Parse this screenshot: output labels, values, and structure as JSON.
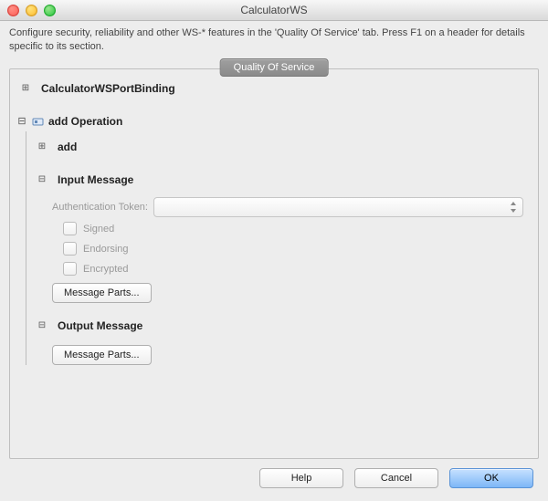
{
  "window": {
    "title": "CalculatorWS"
  },
  "info": "Configure security, reliability and other WS-* features in the 'Quality Of Service' tab. Press F1 on a header for details specific to its section.",
  "tab": {
    "label": "Quality Of Service"
  },
  "tree": {
    "binding": {
      "label": "CalculatorWSPortBinding"
    },
    "operation_group": {
      "label": "add Operation"
    },
    "operation": {
      "label": "add"
    },
    "input_msg": {
      "header": "Input Message",
      "auth_label": "Authentication Token:",
      "auth_value": "",
      "signed": "Signed",
      "endorsing": "Endorsing",
      "encrypted": "Encrypted",
      "message_parts": "Message Parts..."
    },
    "output_msg": {
      "header": "Output Message",
      "message_parts": "Message Parts..."
    }
  },
  "buttons": {
    "help": "Help",
    "cancel": "Cancel",
    "ok": "OK"
  }
}
